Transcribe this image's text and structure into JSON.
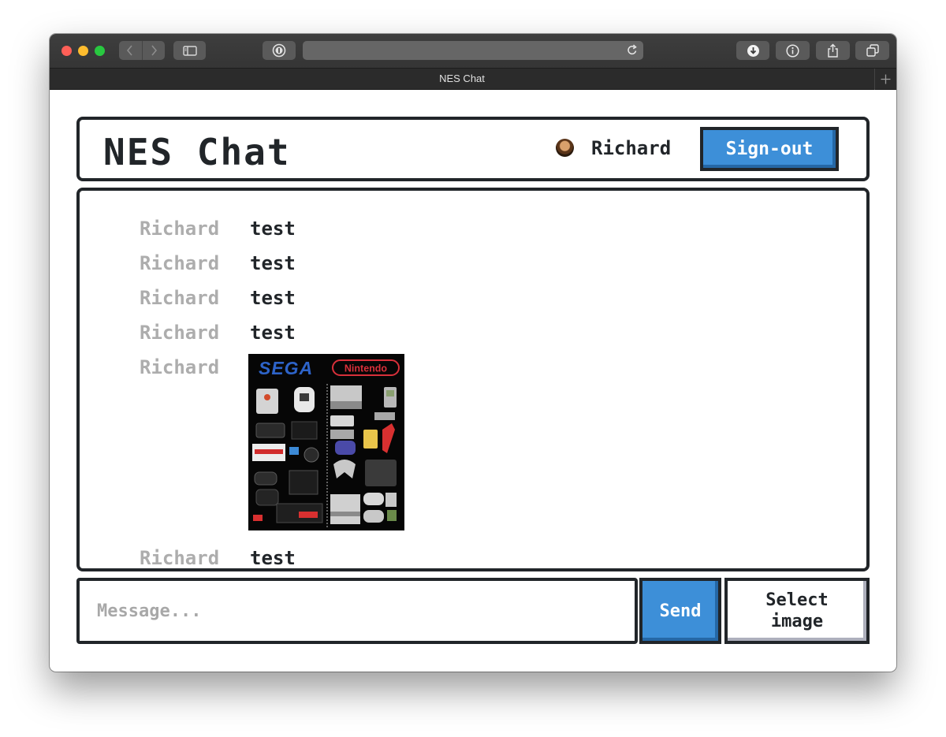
{
  "browser": {
    "tab_title": "NES Chat"
  },
  "header": {
    "title": "NES Chat",
    "username": "Richard",
    "signout_label": "Sign-out"
  },
  "messages": [
    {
      "author": "Richard",
      "text": "test"
    },
    {
      "author": "Richard",
      "text": "test"
    },
    {
      "author": "Richard",
      "text": "test"
    },
    {
      "author": "Richard",
      "text": "test"
    },
    {
      "author": "Richard",
      "image": {
        "logo_left": "SEGA",
        "logo_right": "Nintendo"
      }
    },
    {
      "author": "Richard",
      "text": "test"
    }
  ],
  "composer": {
    "placeholder": "Message...",
    "send_label": "Send",
    "select_image_label": "Select image"
  },
  "colors": {
    "primary": "#3d8fd8",
    "border": "#212529",
    "author_gray": "#adadad"
  }
}
